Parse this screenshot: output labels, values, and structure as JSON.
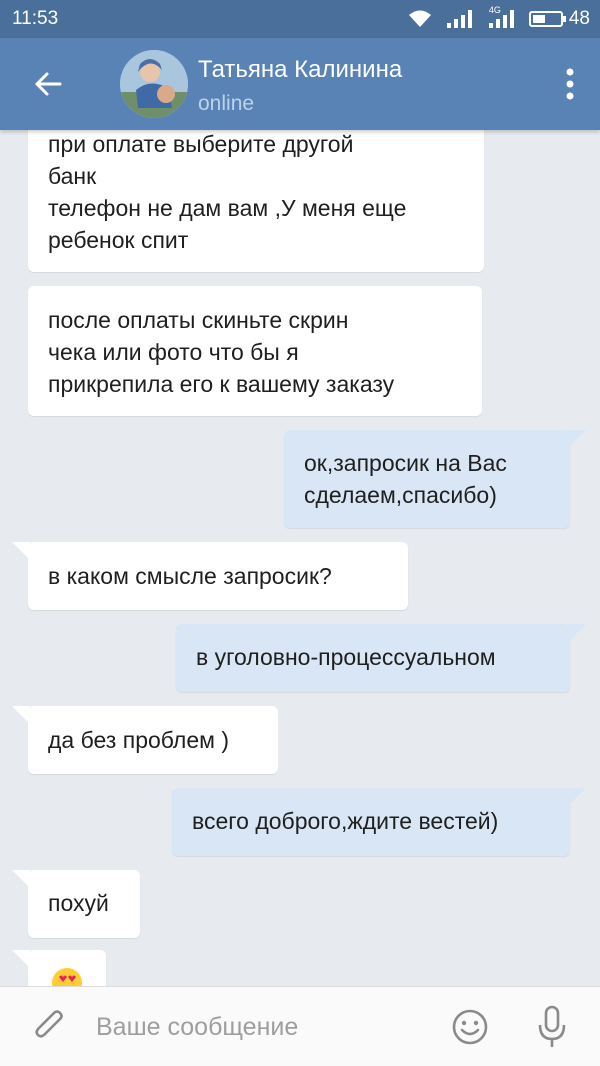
{
  "status_bar": {
    "time": "11:53",
    "network_label": "4G",
    "battery_level": "48"
  },
  "header": {
    "contact_name": "Татьяна Калинина",
    "contact_status": "online",
    "back_icon": "arrow-left-icon",
    "menu_icon": "more-vert-icon"
  },
  "messages": [
    {
      "direction": "in",
      "lines": [
        "при оплате выберите другой",
        "банк",
        "телефон не дам вам ,У меня еще",
        "ребенок спит"
      ]
    },
    {
      "direction": "in",
      "lines": [
        "после оплаты скиньте скрин",
        "чека или фото что бы я",
        "прикрепила его к вашему заказу"
      ]
    },
    {
      "direction": "out",
      "lines": [
        "ок,запросик на Вас",
        "сделаем,спасибо)"
      ]
    },
    {
      "direction": "in",
      "lines": [
        "в каком смысле запросик?"
      ]
    },
    {
      "direction": "out",
      "lines": [
        "в уголовно-процессуальном"
      ]
    },
    {
      "direction": "in",
      "lines": [
        "да без проблем )"
      ]
    },
    {
      "direction": "out",
      "lines": [
        "всего доброго,ждите вестей)"
      ]
    },
    {
      "direction": "in",
      "lines": [
        "похуй"
      ]
    },
    {
      "direction": "in",
      "lines": [],
      "emoji": "heart-eyes-emoji"
    }
  ],
  "composer": {
    "placeholder": "Ваше сообщение",
    "attach_icon": "paperclip-icon",
    "emoji_icon": "smiley-icon",
    "mic_icon": "microphone-icon"
  },
  "colors": {
    "status_bar": "#4a6f9a",
    "header": "#5a83b5",
    "background": "#e7ebf0",
    "incoming_bubble": "#ffffff",
    "outgoing_bubble": "#d9e6f5"
  }
}
